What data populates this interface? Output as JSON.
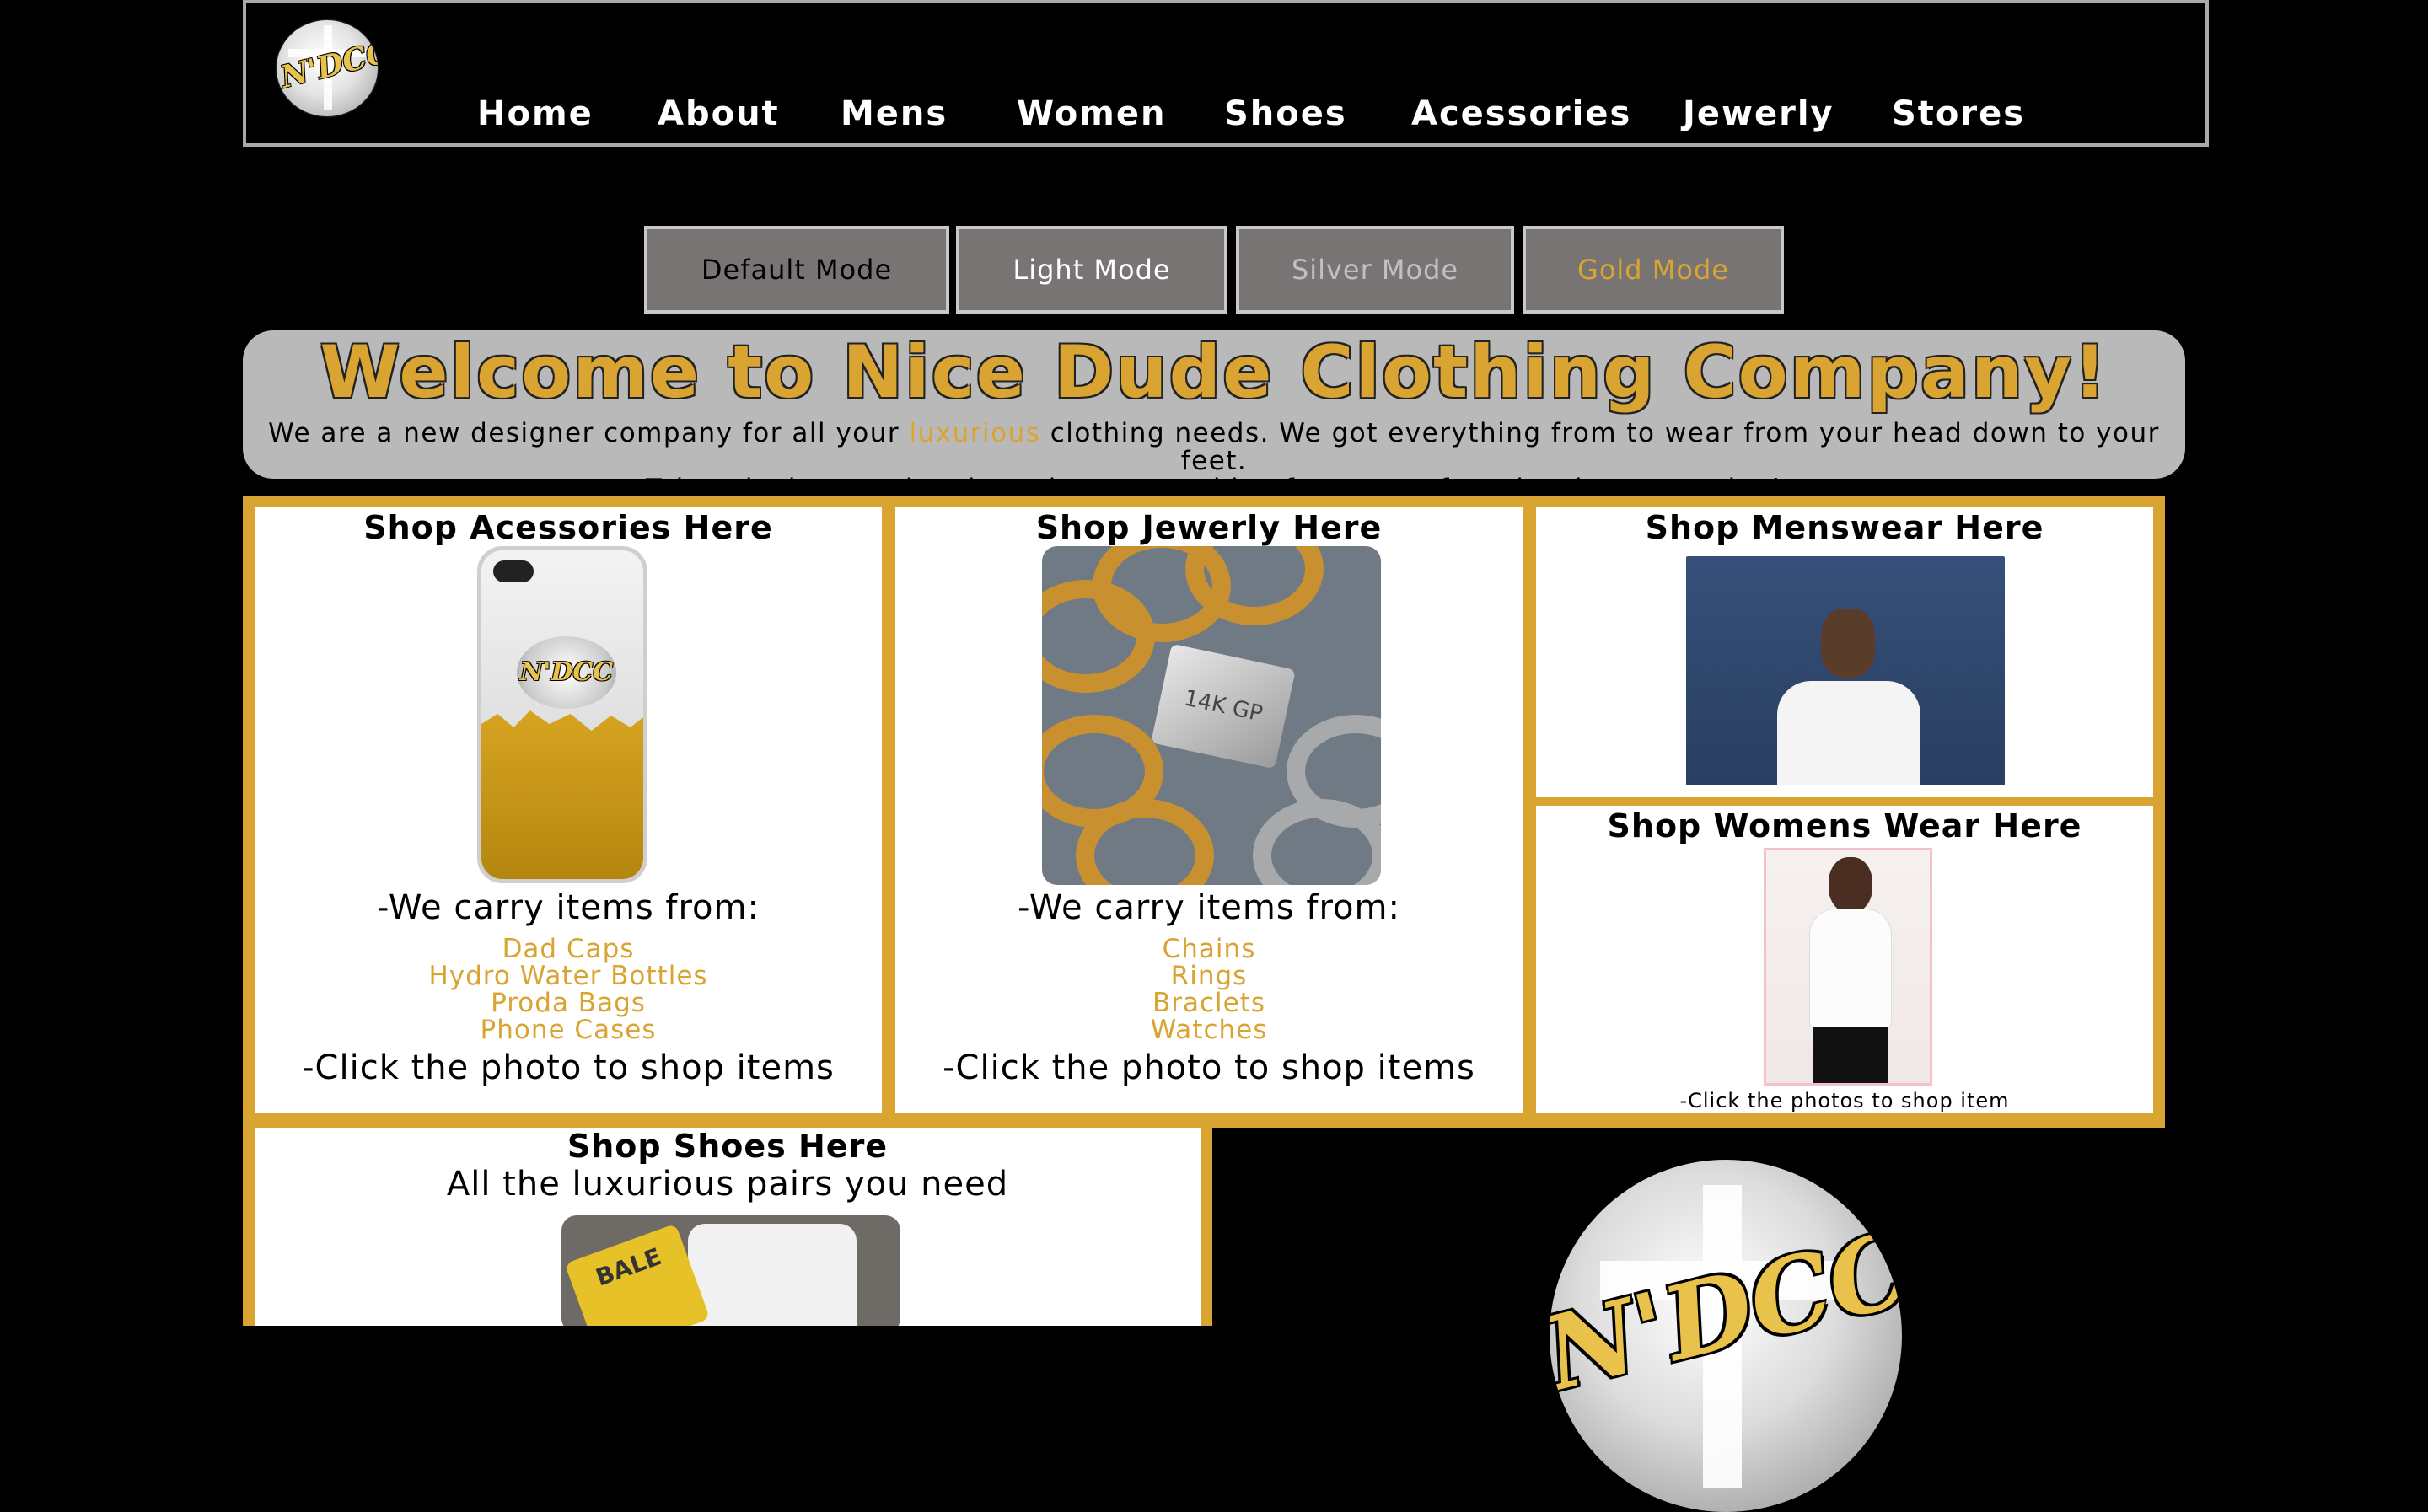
{
  "header": {
    "logo_text": "N'DCC",
    "nav": [
      "Home",
      "About",
      "Mens",
      "Women",
      "Shoes",
      "Acessories",
      "Jewerly",
      "Stores"
    ]
  },
  "modes": {
    "default": "Default Mode",
    "light": "Light Mode",
    "silver": "Silver Mode",
    "gold": "Gold Mode"
  },
  "welcome": {
    "title": "Welcome to Nice Dude Clothing Company!",
    "text_before": "We are a new designer company for all your ",
    "text_highlight": "luxurious",
    "text_after": " clothing needs. We got everything from to wear from your head down to your feet.",
    "text_line2": "Take a look around and purchase something from one of our local stores today!"
  },
  "accessories": {
    "title": "Shop Acessories Here",
    "carry": "-We carry items from:",
    "items": [
      "Dad Caps",
      "Hydro Water Bottles",
      "Proda Bags",
      "Phone Cases"
    ],
    "click": "-Click the photo to shop items",
    "badge": "N'DCC"
  },
  "jewelry": {
    "title": "Shop Jewerly Here",
    "carry": "-We carry items from:",
    "items": [
      "Chains",
      "Rings",
      "Braclets",
      "Watches"
    ],
    "click": "-Click the photo to shop items",
    "clasp": "14K GP"
  },
  "menswear": {
    "title": "Shop Menswear Here"
  },
  "womenswear": {
    "title": "Shop Womens Wear Here",
    "click": "-Click the photos to shop item"
  },
  "shoes": {
    "title": "Shop Shoes Here",
    "subtitle": "All the luxurious pairs you need",
    "strap": "BALE"
  },
  "big_logo_text": "N'DCC",
  "colors": {
    "gold": "#daa432",
    "panel_gray": "#b9b9b9",
    "button_gray": "#787474",
    "silver_text": "#c0c0c0"
  }
}
